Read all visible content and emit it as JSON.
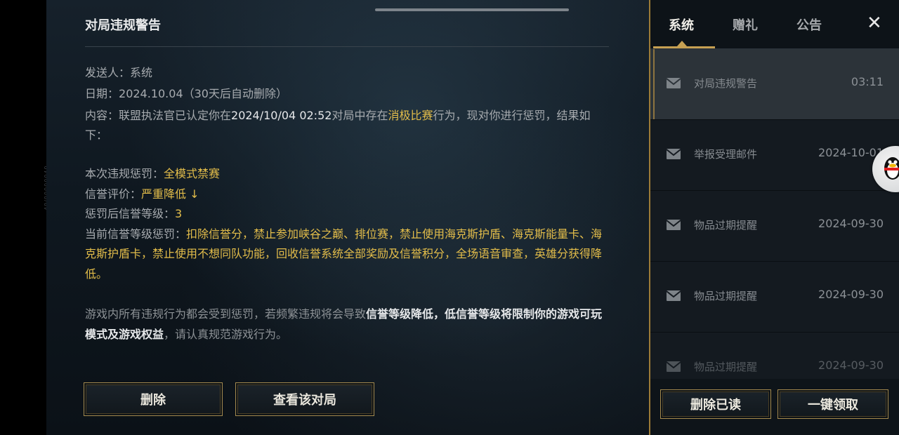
{
  "side_tag": "49/00000040",
  "detail": {
    "title": "对局违规警告",
    "sender_label": "发送人：",
    "sender_value": "系统",
    "date_label": "日期：",
    "date_value": "2024.10.04（30天后自动删除）",
    "content_prefix": "内容：联盟执法官已认定你在",
    "content_time": "2024/10/04 02:52",
    "content_mid": "对局中存在",
    "content_violation": "消极比赛",
    "content_suffix": "行为，现对你进行惩罚，结果如下：",
    "penalty_label": "本次违规惩罚：",
    "penalty_value": "全模式禁赛",
    "credit_label": "信誉评价：",
    "credit_value": "严重降低 ↓",
    "level_label": "惩罚后信誉等级：",
    "level_value": "3",
    "current_label": "当前信誉等级惩罚：",
    "current_value": "扣除信誉分，禁止参加峡谷之巅、排位赛，禁止使用海克斯护盾、海克斯能量卡、海克斯护盾卡，禁止使用不想同队功能，回收信誉系统全部奖励及信誉积分，全场语音审查，英雄分获得降低。",
    "notice_prefix": "游戏内所有违规行为都会受到惩罚，若频繁违规将会导致",
    "notice_bold": "信誉等级降低，低信誉等级将限制你的游戏可玩模式及游戏权益",
    "notice_suffix": "，请认真规范游戏行为。",
    "delete_button": "删除",
    "view_match_button": "查看该对局"
  },
  "right_panel": {
    "tabs": [
      {
        "label": "系统",
        "active": true
      },
      {
        "label": "赠礼",
        "active": false
      },
      {
        "label": "公告",
        "active": false
      }
    ],
    "close_icon": "close-icon",
    "mails": [
      {
        "title": "对局违规警告",
        "date": "03:11",
        "selected": true
      },
      {
        "title": "举报受理邮件",
        "date": "2024-10-01",
        "selected": false
      },
      {
        "title": "物品过期提醒",
        "date": "2024-09-30",
        "selected": false
      },
      {
        "title": "物品过期提醒",
        "date": "2024-09-30",
        "selected": false
      },
      {
        "title": "物品过期提醒",
        "date": "2024-09-30",
        "selected": false
      }
    ],
    "delete_read_button": "删除已读",
    "claim_all_button": "一键领取"
  },
  "colors": {
    "accent_gold": "#e3bd4a",
    "border_gold": "#a48a4f",
    "panel_bg": "#141a20"
  }
}
